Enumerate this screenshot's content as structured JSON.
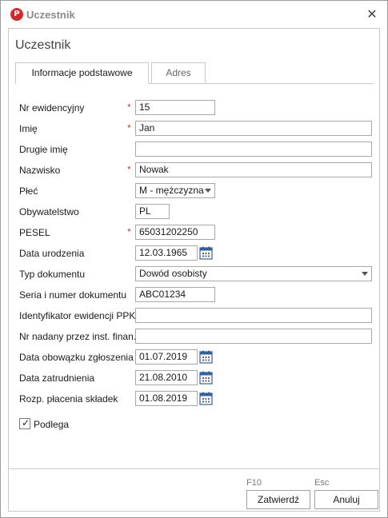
{
  "window": {
    "title": "Uczestnik",
    "app_icon_letter": "P",
    "close_glyph": "✕"
  },
  "heading": "Uczestnik",
  "tabs": [
    {
      "label": "Informacje podstawowe",
      "active": true
    },
    {
      "label": "Adres",
      "active": false
    }
  ],
  "fields": {
    "nr_ewidencyjny": {
      "label": "Nr ewidencyjny",
      "value": "15",
      "required": "*"
    },
    "imie": {
      "label": "Imię",
      "value": "Jan",
      "required": "*"
    },
    "drugie_imie": {
      "label": "Drugie imię",
      "value": ""
    },
    "nazwisko": {
      "label": "Nazwisko",
      "value": "Nowak",
      "required": "*"
    },
    "plec": {
      "label": "Płeć",
      "value": "M - mężczyzna"
    },
    "obywatelstwo": {
      "label": "Obywatelstwo",
      "value": "PL"
    },
    "pesel": {
      "label": "PESEL",
      "value": "65031202250",
      "required": "*"
    },
    "data_urodzenia": {
      "label": "Data urodzenia",
      "value": "12.03.1965"
    },
    "typ_dokumentu": {
      "label": "Typ dokumentu",
      "value": "Dowód osobisty"
    },
    "seria_numer": {
      "label": "Seria i numer dokumentu",
      "value": "ABC01234"
    },
    "identyfikator_ppk": {
      "label": "Identyfikator ewidencji PPK",
      "value": ""
    },
    "nr_nadany": {
      "label": "Nr nadany przez inst. finan.",
      "value": ""
    },
    "data_obowiazku": {
      "label": "Data obowązku zgłoszenia",
      "value": "01.07.2019"
    },
    "data_zatrudnienia": {
      "label": "Data zatrudnienia",
      "value": "21.08.2010"
    },
    "rozp_placenia": {
      "label": "Rozp. płacenia składek",
      "value": "01.08.2019"
    }
  },
  "podlega": {
    "label": "Podlega",
    "checked": true,
    "check_glyph": "✓"
  },
  "footer": {
    "confirm_key": "F10",
    "cancel_key": "Esc",
    "confirm_label": "Zatwierdź",
    "cancel_label": "Anuluj"
  },
  "colors": {
    "required_marker": "#e03030",
    "app_icon": "#d62a2a"
  },
  "icons": {
    "calendar": "calendar-icon",
    "dropdown": "chevron-down-icon",
    "close": "close-icon",
    "app": "app-logo-icon"
  }
}
